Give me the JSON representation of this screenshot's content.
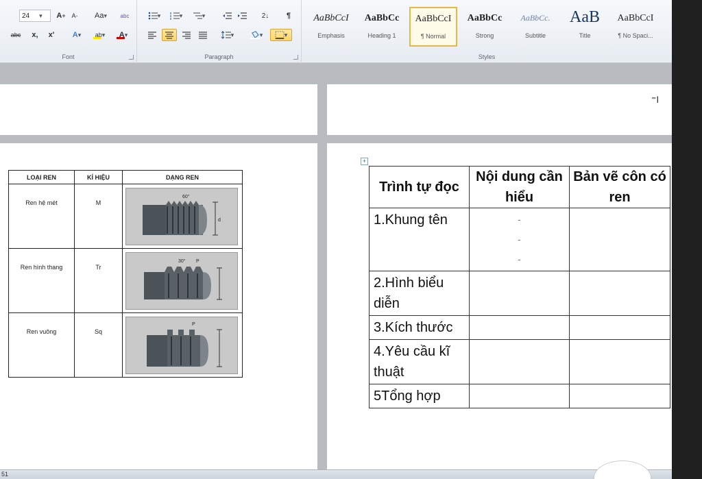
{
  "ribbon": {
    "font": {
      "label": "Font",
      "size": "24",
      "grow": "A",
      "shrink": "A",
      "change_case": "Aa",
      "clear": "abc",
      "strike": "abc",
      "sub": "x,",
      "sup": "x'",
      "effects": "A",
      "highlight": "ab",
      "color": "A"
    },
    "paragraph": {
      "label": "Paragraph",
      "sort": "2↓",
      "pilcrow": "¶"
    },
    "styles": {
      "label": "Styles",
      "items": [
        {
          "sample": "AaBbCcI",
          "name": "Emphasis"
        },
        {
          "sample": "AaBbCc",
          "name": "Heading 1"
        },
        {
          "sample": "AaBbCcI",
          "name": "¶ Normal"
        },
        {
          "sample": "AaBbCc",
          "name": "Strong"
        },
        {
          "sample": "AaBbCc.",
          "name": "Subtitle"
        },
        {
          "sample": "AaB",
          "name": "Title"
        },
        {
          "sample": "AaBbCcI",
          "name": "¶ No Spaci..."
        }
      ]
    }
  },
  "thread_table": {
    "headers": [
      "LOẠI REN",
      "KÍ HIỆU",
      "DẠNG REN"
    ],
    "rows": [
      {
        "type": "Ren hệ mét",
        "symbol": "M"
      },
      {
        "type": "Ren hình thang",
        "symbol": "Tr"
      },
      {
        "type": "Ren vuông",
        "symbol": "Sq"
      }
    ],
    "img_labels": [
      "60°",
      "30°",
      "P",
      "P",
      "d"
    ]
  },
  "read_table": {
    "headers": [
      "Trình tự đọc",
      "Nội dung cần hiểu",
      "Bản vẽ côn có ren"
    ],
    "rows": [
      {
        "step": "1.Khung tên",
        "dashes": [
          "-",
          "-",
          "-"
        ]
      },
      {
        "step": "2.Hình biểu diễn"
      },
      {
        "step": "3.Kích thước"
      },
      {
        "step": "4.Yêu cầu kĩ thuật"
      },
      {
        "step": "5Tổng hợp"
      }
    ]
  },
  "statusbar": {
    "page": "51"
  },
  "colors": {
    "highlight_active": "#ffd563",
    "font_color": "#d00000",
    "ribbon_bg": "#eef2f6"
  }
}
